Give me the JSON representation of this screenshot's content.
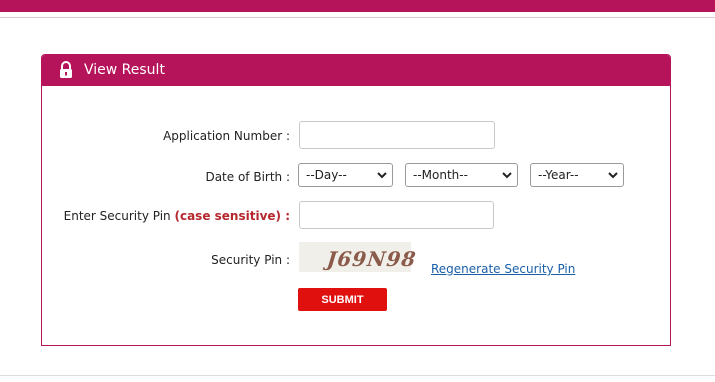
{
  "panel": {
    "title": "View Result",
    "icon": "lock-icon"
  },
  "form": {
    "application_number_label": "Application Number :",
    "application_number_value": "",
    "dob_label": "Date of Birth :",
    "day_selected": "--Day--",
    "month_selected": "--Month--",
    "year_selected": "--Year--",
    "security_pin_entry_label": "Enter Security Pin",
    "security_pin_entry_note": "(case sensitive) :",
    "security_pin_entry_value": "",
    "security_pin_label": "Security Pin :",
    "captcha_text": "J69N98",
    "regenerate_label": "Regenerate Security Pin",
    "submit_label": "SUBMIT"
  },
  "colors": {
    "brand": "#b5145a",
    "submit": "#e0100f",
    "link": "#1a5fa8",
    "emphasis": "#b5282e"
  }
}
